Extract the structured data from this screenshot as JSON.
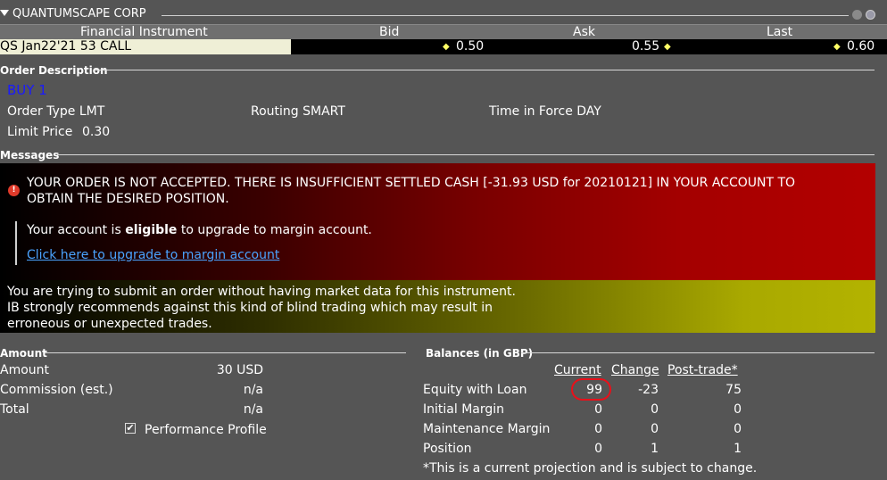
{
  "window": {
    "title": "QUANTUMSCAPE CORP"
  },
  "table": {
    "headers": [
      "Financial Instrument",
      "Bid",
      "Ask",
      "Last"
    ],
    "row": {
      "instrument": "QS Jan22'21 53 CALL",
      "bid": "0.50",
      "ask": "0.55",
      "last": "0.60"
    }
  },
  "order": {
    "section_label": "Order Description",
    "action": "BUY 1",
    "order_type": "Order Type LMT",
    "routing": "Routing SMART",
    "time_in_force": "Time in Force DAY",
    "limit_price_label": "Limit Price",
    "limit_price_value": "0.30"
  },
  "messages": {
    "section_label": "Messages",
    "error_line1": "YOUR ORDER IS NOT ACCEPTED. THERE IS INSUFFICIENT SETTLED CASH [-31.93 USD for 20210121] IN YOUR ACCOUNT TO",
    "error_line2": "OBTAIN THE DESIRED POSITION.",
    "eligible_prefix": "Your account is ",
    "eligible_bold": "eligible",
    "eligible_suffix": " to upgrade to margin account.",
    "upgrade_link": "Click here to upgrade to margin account",
    "warn_line1": "You are trying to submit an order without having market data for this instrument.",
    "warn_line2": "IB strongly recommends against this kind of blind trading which may result in",
    "warn_line3": "erroneous or unexpected trades."
  },
  "amount": {
    "section_label": "Amount",
    "rows": [
      {
        "label": "Amount",
        "value": "30 USD"
      },
      {
        "label": "Commission (est.)",
        "value": "n/a"
      },
      {
        "label": "Total",
        "value": "n/a"
      }
    ],
    "performance_profile_label": "Performance Profile",
    "performance_profile_checked": true
  },
  "balances": {
    "section_label": "Balances (in GBP)",
    "columns": [
      "Current",
      "Change",
      "Post-trade*"
    ],
    "rows": [
      {
        "label": "Equity with Loan",
        "current": "99",
        "change": "-23",
        "post": "75"
      },
      {
        "label": "Initial Margin",
        "current": "0",
        "change": "0",
        "post": "0"
      },
      {
        "label": "Maintenance Margin",
        "current": "0",
        "change": "0",
        "post": "0"
      },
      {
        "label": "Position",
        "current": "0",
        "change": "1",
        "post": "1"
      }
    ],
    "footnote": "*This is a current projection and is subject to change."
  },
  "colors": {
    "error_red": "#b30000",
    "warning_yellow": "#b3b300",
    "link": "#4aa3ff",
    "highlight_ring": "#e8101a"
  }
}
